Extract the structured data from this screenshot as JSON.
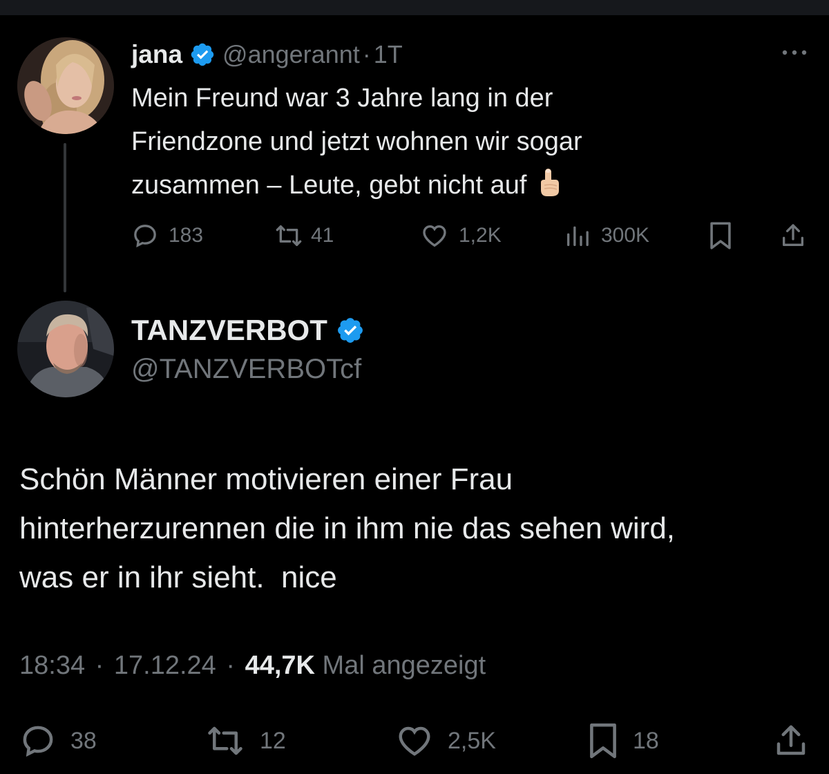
{
  "parent_tweet": {
    "display_name": "jana",
    "handle": "@angerannt",
    "separator": "·",
    "age": "1T",
    "text_lines": [
      "Mein Freund war 3 Jahre lang in der",
      "Friendzone und jetzt wohnen wir sogar",
      "zusammen – Leute, gebt nicht auf"
    ],
    "emoji": "pointing-up-finger",
    "metrics": {
      "replies": "183",
      "reposts": "41",
      "likes": "1,2K",
      "views": "300K"
    }
  },
  "main_tweet": {
    "display_name": "TANZVERBOT",
    "handle": "@TANZVERBOTcf",
    "text_lines": [
      "Schön Männer motivieren einer Frau",
      "hinterherzurennen die in ihm nie das sehen wird,",
      "was er in ihr sieht.  nice"
    ],
    "time": "18:34",
    "sep1": "·",
    "date": "17.12.24",
    "sep2": "·",
    "views_count": "44,7K",
    "views_label": "Mal angezeigt",
    "metrics": {
      "replies": "38",
      "reposts": "12",
      "likes": "2,5K",
      "bookmarks": "18"
    }
  },
  "colors": {
    "background": "#000000",
    "text": "#e7e9ea",
    "muted": "#71767b",
    "verified": "#1d9bf0",
    "thread_line": "#333639"
  },
  "icons": [
    "verified-badge-icon",
    "more-icon",
    "reply-icon",
    "repost-icon",
    "like-icon",
    "views-icon",
    "bookmark-icon",
    "share-icon"
  ]
}
